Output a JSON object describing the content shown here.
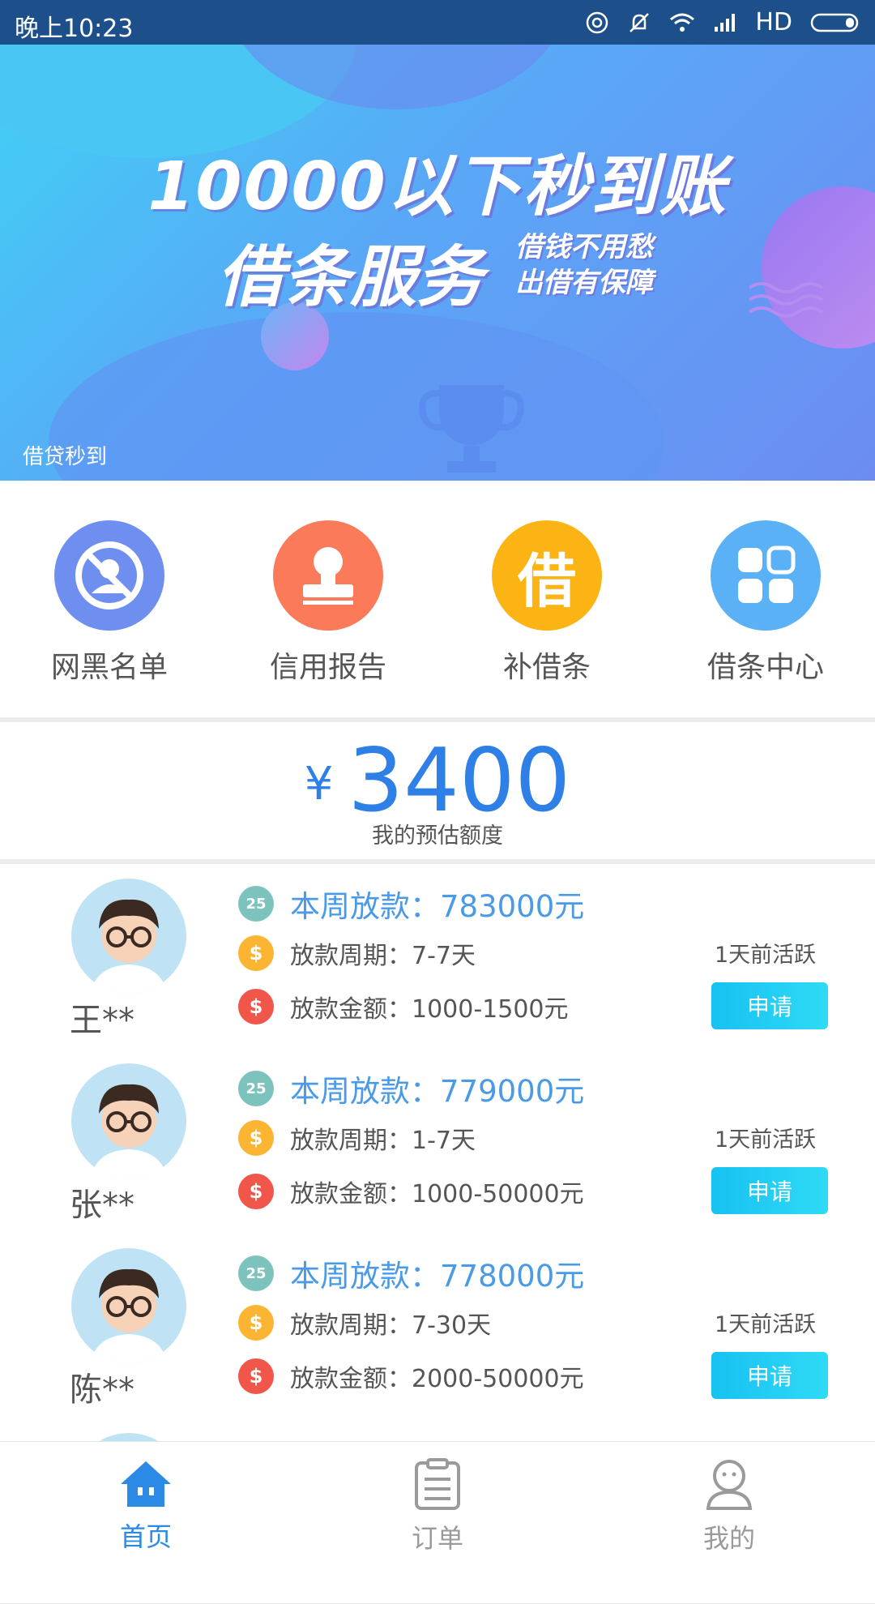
{
  "status_bar": {
    "time": "晚上10:23",
    "network": "HD",
    "icons": [
      "hotspot-icon",
      "mute-icon",
      "wifi-icon",
      "signal-icon",
      "battery-icon"
    ]
  },
  "banner": {
    "headline": "10000以下秒到账",
    "title": "借条服务",
    "slogan_1": "借钱不用愁",
    "slogan_2": "出借有保障",
    "caption": "借贷秒到"
  },
  "quick_menu": [
    {
      "label": "网黑名单",
      "icon": "blacklist-icon",
      "color": "#6e8ff0"
    },
    {
      "label": "信用报告",
      "icon": "stamp-icon",
      "color": "#fa7a59"
    },
    {
      "label": "补借条",
      "icon": "borrow-char-icon",
      "glyph": "借",
      "color": "#fbb414"
    },
    {
      "label": "借条中心",
      "icon": "grid-icon",
      "color": "#5ab1f5"
    }
  ],
  "quota": {
    "currency": "¥",
    "amount": "3400",
    "label": "我的预估额度"
  },
  "lenders": [
    {
      "name": "王**",
      "weekly": "本周放款：783000元",
      "period": "放款周期：7-7天",
      "amount": "放款金额：1000-1500元",
      "active": "1天前活跃",
      "apply": "申请"
    },
    {
      "name": "张**",
      "weekly": "本周放款：779000元",
      "period": "放款周期：1-7天",
      "amount": "放款金额：1000-50000元",
      "active": "1天前活跃",
      "apply": "申请"
    },
    {
      "name": "陈**",
      "weekly": "本周放款：778000元",
      "period": "放款周期：7-30天",
      "amount": "放款金额：2000-50000元",
      "active": "1天前活跃",
      "apply": "申请"
    }
  ],
  "row_icons": {
    "calendar_text": "25",
    "coin_text": "$",
    "dollar_text": "$"
  },
  "tabs": [
    {
      "label": "首页",
      "icon": "home-icon",
      "active": true
    },
    {
      "label": "订单",
      "icon": "order-icon",
      "active": false
    },
    {
      "label": "我的",
      "icon": "profile-icon",
      "active": false
    }
  ],
  "colors": {
    "status_bar": "#1d4f8b",
    "accent_blue": "#2f80e6",
    "apply_button": "#17c1f1",
    "tab_active": "#2a8ae6",
    "tab_inactive": "#9a9a9a"
  }
}
